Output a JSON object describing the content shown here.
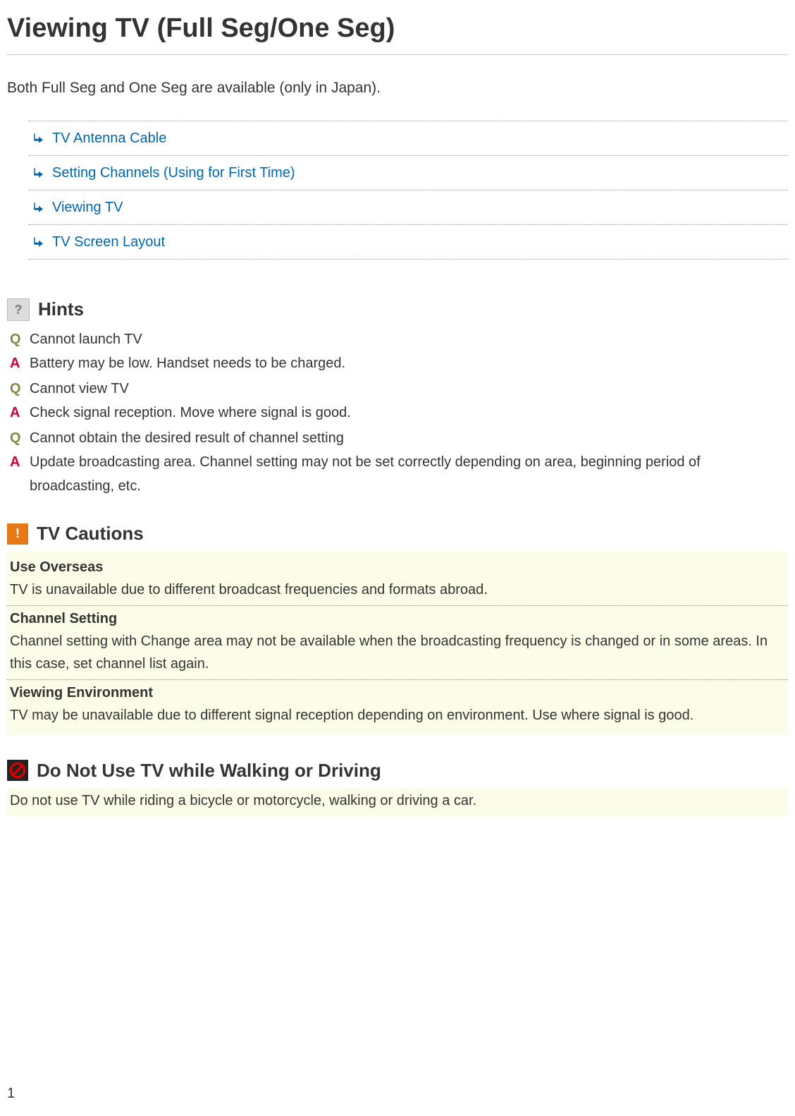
{
  "title": "Viewing TV (Full Seg/One Seg)",
  "intro": "Both Full Seg and One Seg are available (only in Japan).",
  "toc": [
    "TV Antenna Cable",
    "Setting Channels (Using for First Time)",
    "Viewing TV",
    "TV Screen Layout"
  ],
  "hints": {
    "heading": "Hints",
    "icon_text": "?",
    "items": [
      {
        "q": "Cannot launch TV",
        "a": "Battery may be low. Handset needs to be charged."
      },
      {
        "q": "Cannot view TV",
        "a": "Check signal reception. Move where signal is good."
      },
      {
        "q": "Cannot obtain the desired result of channel setting",
        "a": "Update broadcasting area. Channel setting may not be set correctly depending on area, beginning period of broadcasting, etc."
      }
    ]
  },
  "cautions": {
    "heading": "TV Cautions",
    "icon_text": "!",
    "items": [
      {
        "title": "Use Overseas",
        "text": "TV is unavailable due to different broadcast frequencies and formats abroad."
      },
      {
        "title": "Channel Setting",
        "text": "Channel setting with Change area may not be available when the broadcasting frequency is changed or in some areas. In this case, set channel list again."
      },
      {
        "title": "Viewing Environment",
        "text": "TV may be unavailable due to different signal reception depending on environment. Use where signal is good."
      }
    ]
  },
  "prohibit": {
    "heading": "Do Not Use TV while Walking or Driving",
    "text": "Do not use TV while riding a bicycle or motorcycle, walking or driving a car."
  },
  "labels": {
    "q": "Q",
    "a": "A"
  },
  "page_number": "1"
}
